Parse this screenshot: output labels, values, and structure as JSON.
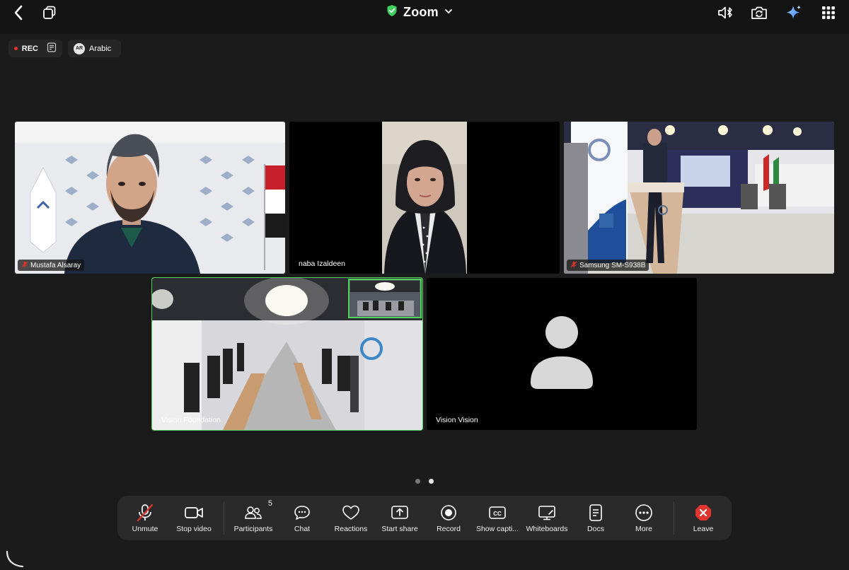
{
  "header": {
    "title": "Zoom",
    "icons": [
      "back-chevron-icon",
      "pip-window-icon",
      "shield-check-icon",
      "chevron-down-icon",
      "speaker-bluetooth-icon",
      "camera-flip-icon",
      "ai-sparkle-icon",
      "grid-menu-icon"
    ],
    "shield_color": "#3ecf5f"
  },
  "status": {
    "rec_label": "REC",
    "language_code": "AR",
    "language_label": "Arabic"
  },
  "participants": [
    {
      "name": "Mustafa Alsaray",
      "muted": true
    },
    {
      "name": "naba Izaldeen",
      "muted": false
    },
    {
      "name": "Samsung SM-S938B",
      "muted": true
    },
    {
      "name": "Vision Foundation",
      "muted": false,
      "active_speaker": true
    },
    {
      "name": "Vision Vision",
      "muted": false,
      "video_off": true
    }
  ],
  "pager": {
    "pages": 2,
    "current": 2
  },
  "toolbar": {
    "unmute": "Unmute",
    "stop_video": "Stop video",
    "participants": "Participants",
    "participants_count": "5",
    "chat": "Chat",
    "reactions": "Reactions",
    "start_share": "Start share",
    "record": "Record",
    "show_captions": "Show capti...",
    "whiteboards": "Whiteboards",
    "docs": "Docs",
    "more": "More",
    "leave": "Leave"
  },
  "colors": {
    "active_speaker_border": "#4fd35d",
    "rec_dot": "#e0342f",
    "muted_icon": "#e0342f",
    "leave_icon": "#e0342f",
    "background": "#1b1b1b"
  }
}
